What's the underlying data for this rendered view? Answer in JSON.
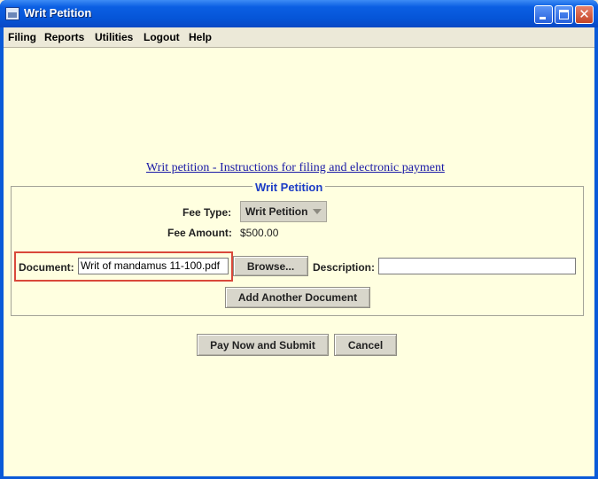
{
  "window": {
    "title": "Writ Petition",
    "minimize_icon": "minimize-icon",
    "maximize_icon": "maximize-icon",
    "close_icon": "close-icon",
    "close_glyph": "✕"
  },
  "menu": {
    "items": [
      {
        "label": "Filing"
      },
      {
        "label": "Reports"
      },
      {
        "label": "Utilities"
      },
      {
        "label": "Logout"
      },
      {
        "label": "Help"
      }
    ]
  },
  "content": {
    "instructions_link": "Writ petition - Instructions for filing and electronic payment ",
    "panel_title": "Writ Petition",
    "fee_type_label": "Fee Type:",
    "fee_type_value": "Writ Petition",
    "fee_amount_label": "Fee Amount:",
    "fee_amount_value": "$500.00",
    "document_label": "Document:",
    "document_value": "Writ of mandamus 11-100.pdf",
    "browse_button": "Browse...",
    "description_label": "Description:",
    "description_value": "",
    "add_document_button": "Add Another Document",
    "pay_submit_button": "Pay Now and Submit",
    "cancel_button": "Cancel"
  },
  "colors": {
    "titlebar": "#0554d6",
    "content_background": "#ffffe0",
    "panel_title": "#1c3cc5",
    "link": "#1a1aa6",
    "highlight_border": "#d9483b"
  }
}
